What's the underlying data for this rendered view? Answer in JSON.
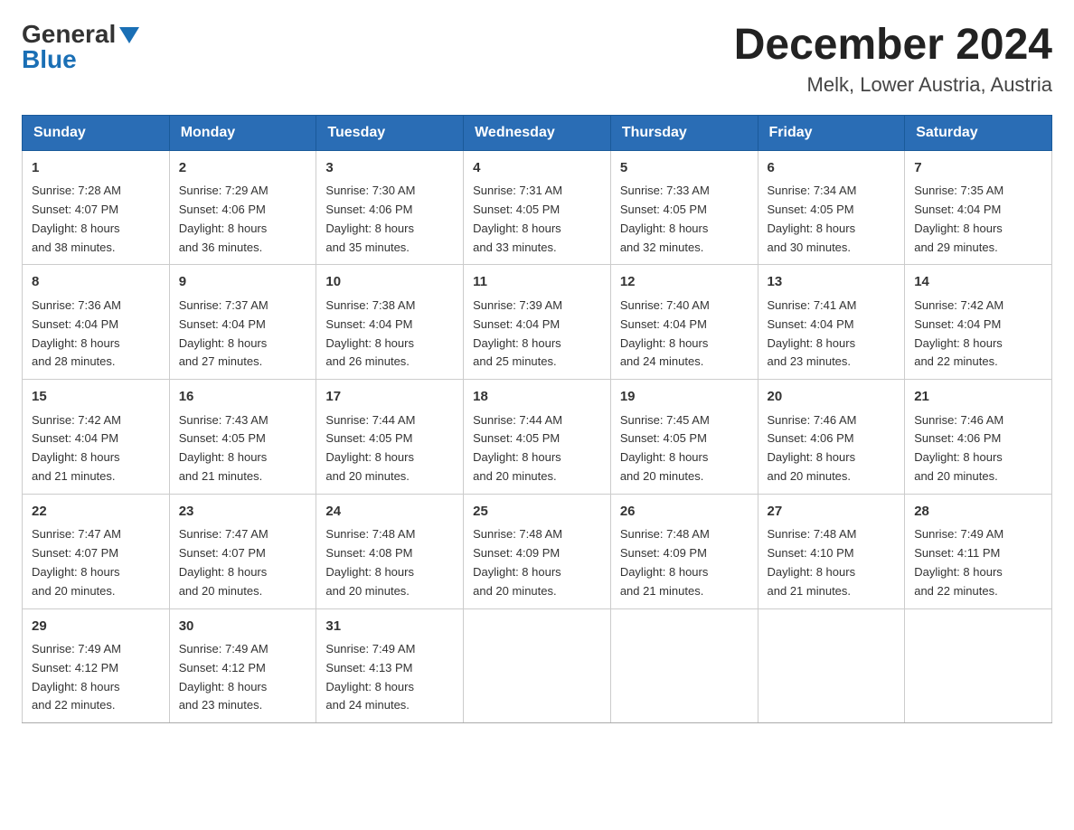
{
  "logo": {
    "general": "General",
    "blue": "Blue"
  },
  "title": "December 2024",
  "location": "Melk, Lower Austria, Austria",
  "days_of_week": [
    "Sunday",
    "Monday",
    "Tuesday",
    "Wednesday",
    "Thursday",
    "Friday",
    "Saturday"
  ],
  "weeks": [
    [
      {
        "day": "1",
        "sunrise": "7:28 AM",
        "sunset": "4:07 PM",
        "daylight": "8 hours and 38 minutes."
      },
      {
        "day": "2",
        "sunrise": "7:29 AM",
        "sunset": "4:06 PM",
        "daylight": "8 hours and 36 minutes."
      },
      {
        "day": "3",
        "sunrise": "7:30 AM",
        "sunset": "4:06 PM",
        "daylight": "8 hours and 35 minutes."
      },
      {
        "day": "4",
        "sunrise": "7:31 AM",
        "sunset": "4:05 PM",
        "daylight": "8 hours and 33 minutes."
      },
      {
        "day": "5",
        "sunrise": "7:33 AM",
        "sunset": "4:05 PM",
        "daylight": "8 hours and 32 minutes."
      },
      {
        "day": "6",
        "sunrise": "7:34 AM",
        "sunset": "4:05 PM",
        "daylight": "8 hours and 30 minutes."
      },
      {
        "day": "7",
        "sunrise": "7:35 AM",
        "sunset": "4:04 PM",
        "daylight": "8 hours and 29 minutes."
      }
    ],
    [
      {
        "day": "8",
        "sunrise": "7:36 AM",
        "sunset": "4:04 PM",
        "daylight": "8 hours and 28 minutes."
      },
      {
        "day": "9",
        "sunrise": "7:37 AM",
        "sunset": "4:04 PM",
        "daylight": "8 hours and 27 minutes."
      },
      {
        "day": "10",
        "sunrise": "7:38 AM",
        "sunset": "4:04 PM",
        "daylight": "8 hours and 26 minutes."
      },
      {
        "day": "11",
        "sunrise": "7:39 AM",
        "sunset": "4:04 PM",
        "daylight": "8 hours and 25 minutes."
      },
      {
        "day": "12",
        "sunrise": "7:40 AM",
        "sunset": "4:04 PM",
        "daylight": "8 hours and 24 minutes."
      },
      {
        "day": "13",
        "sunrise": "7:41 AM",
        "sunset": "4:04 PM",
        "daylight": "8 hours and 23 minutes."
      },
      {
        "day": "14",
        "sunrise": "7:42 AM",
        "sunset": "4:04 PM",
        "daylight": "8 hours and 22 minutes."
      }
    ],
    [
      {
        "day": "15",
        "sunrise": "7:42 AM",
        "sunset": "4:04 PM",
        "daylight": "8 hours and 21 minutes."
      },
      {
        "day": "16",
        "sunrise": "7:43 AM",
        "sunset": "4:05 PM",
        "daylight": "8 hours and 21 minutes."
      },
      {
        "day": "17",
        "sunrise": "7:44 AM",
        "sunset": "4:05 PM",
        "daylight": "8 hours and 20 minutes."
      },
      {
        "day": "18",
        "sunrise": "7:44 AM",
        "sunset": "4:05 PM",
        "daylight": "8 hours and 20 minutes."
      },
      {
        "day": "19",
        "sunrise": "7:45 AM",
        "sunset": "4:05 PM",
        "daylight": "8 hours and 20 minutes."
      },
      {
        "day": "20",
        "sunrise": "7:46 AM",
        "sunset": "4:06 PM",
        "daylight": "8 hours and 20 minutes."
      },
      {
        "day": "21",
        "sunrise": "7:46 AM",
        "sunset": "4:06 PM",
        "daylight": "8 hours and 20 minutes."
      }
    ],
    [
      {
        "day": "22",
        "sunrise": "7:47 AM",
        "sunset": "4:07 PM",
        "daylight": "8 hours and 20 minutes."
      },
      {
        "day": "23",
        "sunrise": "7:47 AM",
        "sunset": "4:07 PM",
        "daylight": "8 hours and 20 minutes."
      },
      {
        "day": "24",
        "sunrise": "7:48 AM",
        "sunset": "4:08 PM",
        "daylight": "8 hours and 20 minutes."
      },
      {
        "day": "25",
        "sunrise": "7:48 AM",
        "sunset": "4:09 PM",
        "daylight": "8 hours and 20 minutes."
      },
      {
        "day": "26",
        "sunrise": "7:48 AM",
        "sunset": "4:09 PM",
        "daylight": "8 hours and 21 minutes."
      },
      {
        "day": "27",
        "sunrise": "7:48 AM",
        "sunset": "4:10 PM",
        "daylight": "8 hours and 21 minutes."
      },
      {
        "day": "28",
        "sunrise": "7:49 AM",
        "sunset": "4:11 PM",
        "daylight": "8 hours and 22 minutes."
      }
    ],
    [
      {
        "day": "29",
        "sunrise": "7:49 AM",
        "sunset": "4:12 PM",
        "daylight": "8 hours and 22 minutes."
      },
      {
        "day": "30",
        "sunrise": "7:49 AM",
        "sunset": "4:12 PM",
        "daylight": "8 hours and 23 minutes."
      },
      {
        "day": "31",
        "sunrise": "7:49 AM",
        "sunset": "4:13 PM",
        "daylight": "8 hours and 24 minutes."
      },
      null,
      null,
      null,
      null
    ]
  ],
  "labels": {
    "sunrise": "Sunrise:",
    "sunset": "Sunset:",
    "daylight": "Daylight:"
  }
}
